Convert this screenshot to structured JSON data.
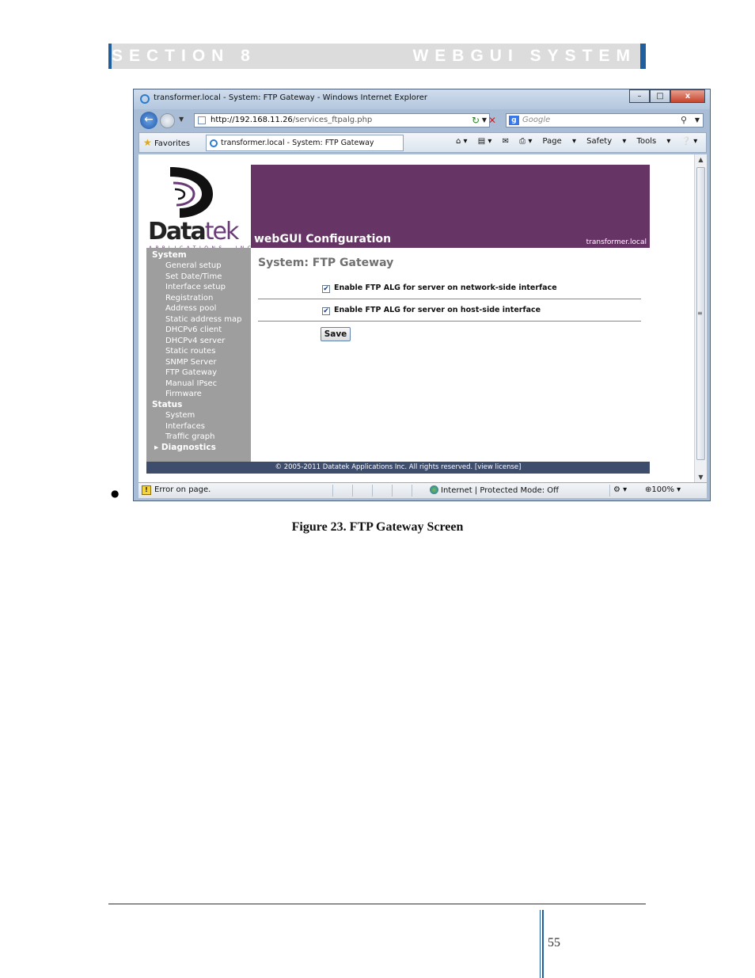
{
  "section": {
    "left": "SECTION 8",
    "right": "WEBGUI SYSTEM"
  },
  "browser": {
    "title": "transformer.local - System: FTP Gateway - Windows Internet Explorer",
    "window_buttons": {
      "minimize": "–",
      "maximize": "□",
      "close": "x"
    },
    "url_host": "http://192.168.11.26",
    "url_path": "/services_ftpalg.php",
    "search_placeholder": "Google",
    "favorites_label": "Favorites",
    "tab_title": "transformer.local - System: FTP Gateway",
    "toolbar": {
      "page": "Page",
      "safety": "Safety",
      "tools": "Tools"
    },
    "status": {
      "error": "Error on page.",
      "zone": "Internet | Protected Mode: Off",
      "zoom": "100%"
    }
  },
  "webgui": {
    "logo_main": "Data",
    "logo_tek": "tek",
    "logo_sub": "APPLICATIONS, INC",
    "banner_title": "webGUI Configuration",
    "hostname": "transformer.local",
    "sidebar": {
      "system_heading": "System",
      "system_items": [
        "General setup",
        "Set Date/Time",
        "Interface setup",
        "Registration",
        "Address pool",
        "Static address map",
        "DHCPv6 client",
        "DHCPv4 server",
        "Static routes",
        "SNMP Server",
        "FTP Gateway",
        "Manual IPsec",
        "Firmware"
      ],
      "status_heading": "Status",
      "status_items": [
        "System",
        "Interfaces",
        "Traffic graph"
      ],
      "diagnostics": "▸ Diagnostics"
    },
    "page_title": "System: FTP Gateway",
    "options": [
      {
        "label": "Enable FTP ALG for server on network-side interface",
        "checked": true
      },
      {
        "label": "Enable FTP ALG for server on host-side interface",
        "checked": true
      }
    ],
    "save_label": "Save",
    "footer": "© 2005-2011 Datatek Applications Inc. All rights reserved.  [view license]"
  },
  "caption": "Figure 23. FTP Gateway Screen",
  "page_number": "55"
}
